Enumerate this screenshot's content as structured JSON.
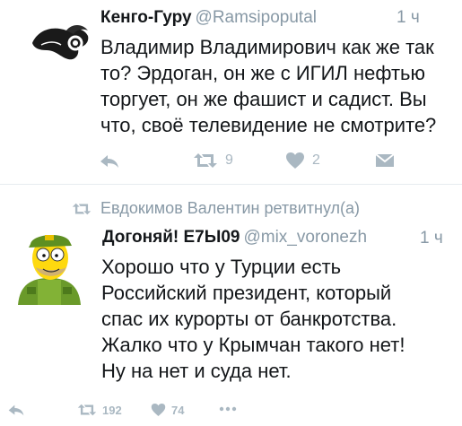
{
  "tweets": [
    {
      "display_name": "Кенго-Гуру",
      "handle": "@Ramsipoputal",
      "time": "1 ч",
      "text": "Владимир Владимирович как же так\nто? Эрдоган, он же с ИГИЛ нефтью\nторгует, он же фашист и садист.  Вы\nчто, своё телевидение не смотрите?",
      "retweet_count": "9",
      "like_count": "2"
    },
    {
      "retweeted_by": "Евдокимов Валентин ретвитнул(а)",
      "display_name": "Догоняй! E7Ы09",
      "handle": "@mix_voronezh",
      "time": "1 ч",
      "text": "Хорошо что у Турции есть\nРоссийский президент, который\nспас их курорты от банкротства.\nЖалко что у Крымчан такого нет!\nНу на нет и суда нет.",
      "retweet_count": "192",
      "like_count": "74"
    }
  ],
  "icons": {
    "reply": "reply-icon",
    "retweet": "retweet-icon",
    "like": "heart-icon",
    "message": "envelope-icon",
    "more": "more-dots-icon"
  },
  "colors": {
    "text": "#14171a",
    "muted": "#8899a6",
    "icon": "#aab8c2",
    "divider": "#e6ecf0"
  }
}
